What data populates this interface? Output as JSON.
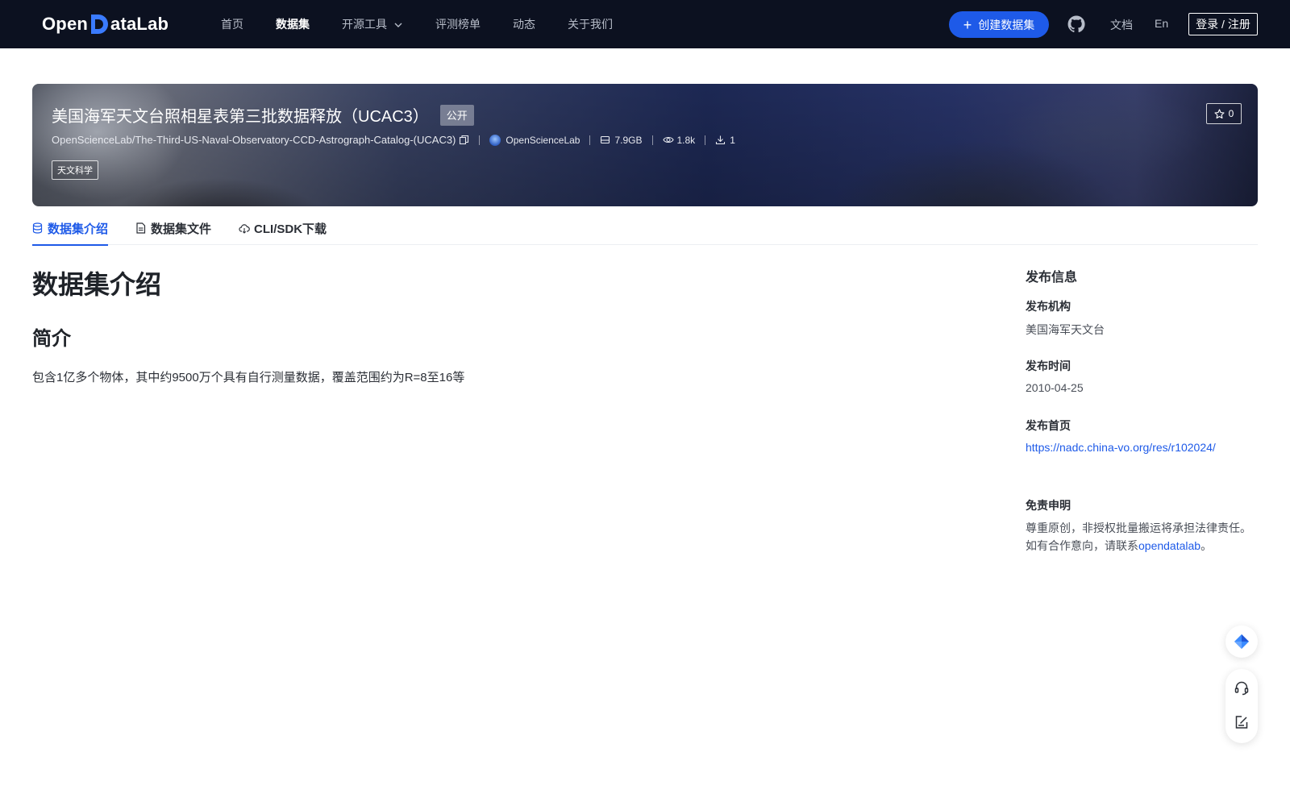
{
  "nav": {
    "logo_text_left": "Open",
    "logo_text_right": "ataLab",
    "items": [
      {
        "label": "首页"
      },
      {
        "label": "数据集"
      },
      {
        "label": "开源工具"
      },
      {
        "label": "评测榜单"
      },
      {
        "label": "动态"
      },
      {
        "label": "关于我们"
      }
    ],
    "create_label": "创建数据集",
    "doc_label": "文档",
    "lang_label": "En",
    "login_label": "登录 / 注册"
  },
  "dataset": {
    "title": "美国海军天文台照相星表第三批数据释放（UCAC3）",
    "visibility": "公开",
    "repo_path": "OpenScienceLab/The-Third-US-Naval-Observatory-CCD-Astrograph-Catalog-(UCAC3)",
    "owner": "OpenScienceLab",
    "size": "7.9GB",
    "views": "1.8k",
    "downloads": "1",
    "tag": "天文科学",
    "stars": "0"
  },
  "tabs": [
    {
      "label": "数据集介绍"
    },
    {
      "label": "数据集文件"
    },
    {
      "label": "CLI/SDK下载"
    }
  ],
  "content": {
    "heading": "数据集介绍",
    "subheading": "简介",
    "paragraph": "包含1亿多个物体，其中约9500万个具有自行测量数据，覆盖范围约为R=8至16等"
  },
  "sidebar": {
    "title": "发布信息",
    "org_label": "发布机构",
    "org_value": "美国海军天文台",
    "time_label": "发布时间",
    "time_value": "2010-04-25",
    "home_label": "发布首页",
    "home_value": "https://nadc.china-vo.org/res/r102024/",
    "disclaimer_label": "免责申明",
    "disclaimer_line1": "尊重原创，非授权批量搬运将承担法律责任。",
    "disclaimer_line2_prefix": "如有合作意向，请联系",
    "disclaimer_link": "opendatalab",
    "disclaimer_line2_suffix": "。"
  },
  "colors": {
    "nav_bg": "#0c1120",
    "accent": "#1e5ae8"
  },
  "icons": [
    "chevron-down-icon",
    "plus-icon",
    "github-icon",
    "copy-icon",
    "database-icon",
    "eye-icon",
    "download-icon",
    "star-icon",
    "file-icon",
    "cloud-icon",
    "assistant-icon",
    "headset-icon",
    "feedback-icon"
  ]
}
